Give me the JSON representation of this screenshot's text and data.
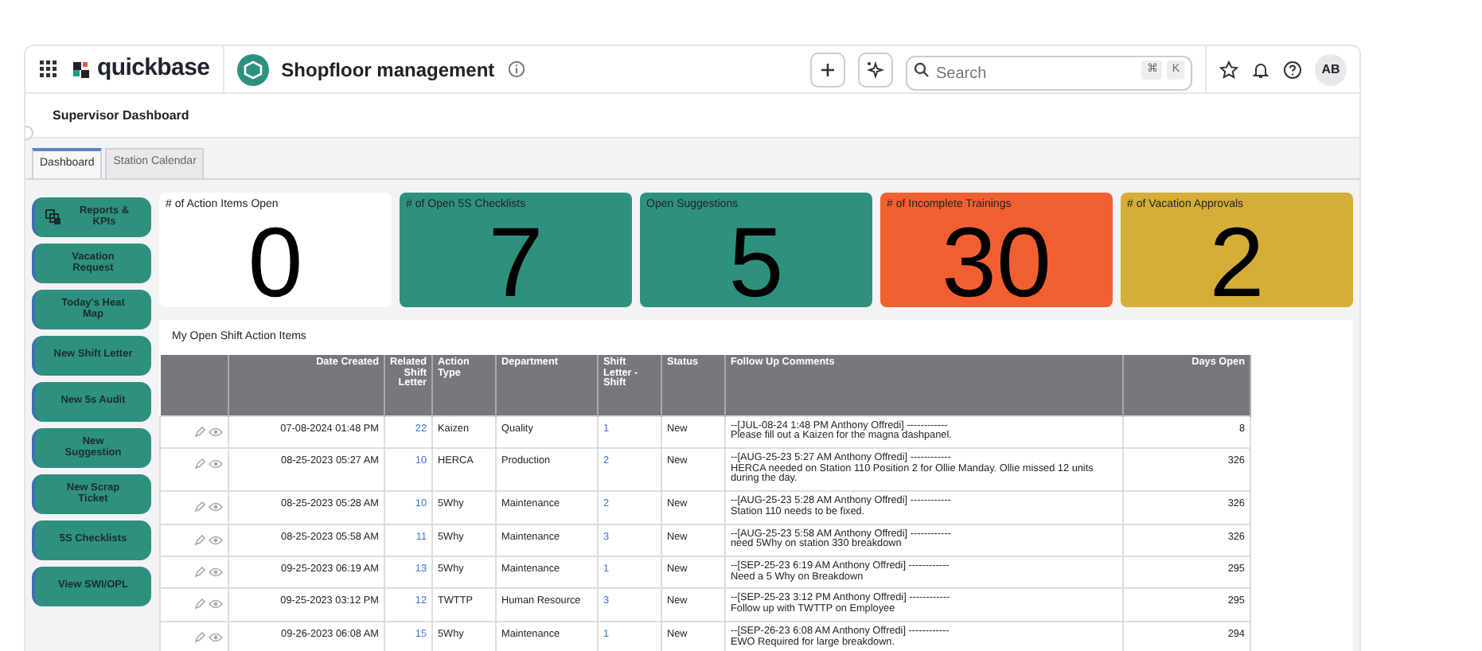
{
  "header": {
    "logo": "quickbase",
    "app_title": "Shopfloor management",
    "search": {
      "placeholder": "Search",
      "keys": [
        "⌘",
        "K"
      ]
    },
    "avatar": "AB"
  },
  "page_title": "Supervisor Dashboard",
  "tabs": [
    {
      "label": "Dashboard",
      "selected": true
    },
    {
      "label": "Station Calendar",
      "selected": false
    }
  ],
  "sidebar_buttons": [
    {
      "label": "Reports & KPIs",
      "kind": "icon"
    },
    {
      "label": "Vacation Request",
      "kind": "text"
    },
    {
      "label": "Today's Heat Map",
      "kind": "text"
    },
    {
      "label": "New Shift Letter",
      "kind": "text"
    },
    {
      "label": "New 5s Audit",
      "kind": "text"
    },
    {
      "label": "New Suggestion",
      "kind": "text"
    },
    {
      "label": "New Scrap Ticket",
      "kind": "text"
    },
    {
      "label": "5S Checklists",
      "kind": "text"
    },
    {
      "label": "View SWI/OPL",
      "kind": "text"
    }
  ],
  "tiles": [
    {
      "title": "# of Action Items Open",
      "value": "0",
      "color": "#ffffff"
    },
    {
      "title": "# of Open 5S Checklists",
      "value": "7",
      "color": "#2e9180"
    },
    {
      "title": "Open Suggestions",
      "value": "5",
      "color": "#2e9180"
    },
    {
      "title": "# of Incomplete Trainings",
      "value": "30",
      "color": "#f26031"
    },
    {
      "title": "# of Vacation Approvals",
      "value": "2",
      "color": "#d4ae36"
    }
  ],
  "table": {
    "title": "My Open Shift Action Items",
    "columns": [
      "Date Created",
      "Related Shift Letter",
      "Action Type",
      "Department",
      "Shift Letter - Shift",
      "Status",
      "Follow Up Comments",
      "Days Open"
    ],
    "rows": [
      {
        "date": "07-08-2024 01:48 PM",
        "related": "22",
        "action": "Kaizen",
        "department": "Quality",
        "shift": "1",
        "status": "New",
        "comment_head": "--[JUL-08-24  1:48 PM  Anthony Offredi] ------------",
        "comment_body": "Please fill out a Kaizen for the magna dashpanel.",
        "days": "8"
      },
      {
        "date": "08-25-2023 05:27 AM",
        "related": "10",
        "action": "HERCA",
        "department": "Production",
        "shift": "2",
        "status": "New",
        "comment_head": "--[AUG-25-23  5:27 AM  Anthony Offredi] ------------",
        "comment_body": "HERCA needed on Station 110 Position 2 for Ollie Manday.  Ollie missed 12 units during the day.",
        "days": "326"
      },
      {
        "date": "08-25-2023 05:28 AM",
        "related": "10",
        "action": "5Why",
        "department": "Maintenance",
        "shift": "2",
        "status": "New",
        "comment_head": "--[AUG-25-23  5:28 AM  Anthony Offredi] ------------",
        "comment_body": "Station 110 needs to be fixed.",
        "days": "326"
      },
      {
        "date": "08-25-2023 05:58 AM",
        "related": "11",
        "action": "5Why",
        "department": "Maintenance",
        "shift": "3",
        "status": "New",
        "comment_head": "--[AUG-25-23  5:58 AM  Anthony Offredi] ------------",
        "comment_body": "need 5Why on station 330 breakdown",
        "days": "326"
      },
      {
        "date": "09-25-2023 06:19 AM",
        "related": "13",
        "action": "5Why",
        "department": "Maintenance",
        "shift": "1",
        "status": "New",
        "comment_head": "--[SEP-25-23  6:19 AM  Anthony Offredi] ------------",
        "comment_body": "Need a 5 Why on Breakdown",
        "days": "295"
      },
      {
        "date": "09-25-2023 03:12 PM",
        "related": "12",
        "action": "TWTTP",
        "department": "Human Resource",
        "shift": "3",
        "status": "New",
        "comment_head": "--[SEP-25-23  3:12 PM  Anthony Offredi] ------------",
        "comment_body": "Follow up with TWTTP on Employee",
        "days": "295"
      },
      {
        "date": "09-26-2023 06:08 AM",
        "related": "15",
        "action": "5Why",
        "department": "Maintenance",
        "shift": "1",
        "status": "New",
        "comment_head": "--[SEP-26-23  6:08 AM  Anthony Offredi] ------------",
        "comment_body": "EWO Required for large breakdown.",
        "days": "294"
      }
    ]
  }
}
